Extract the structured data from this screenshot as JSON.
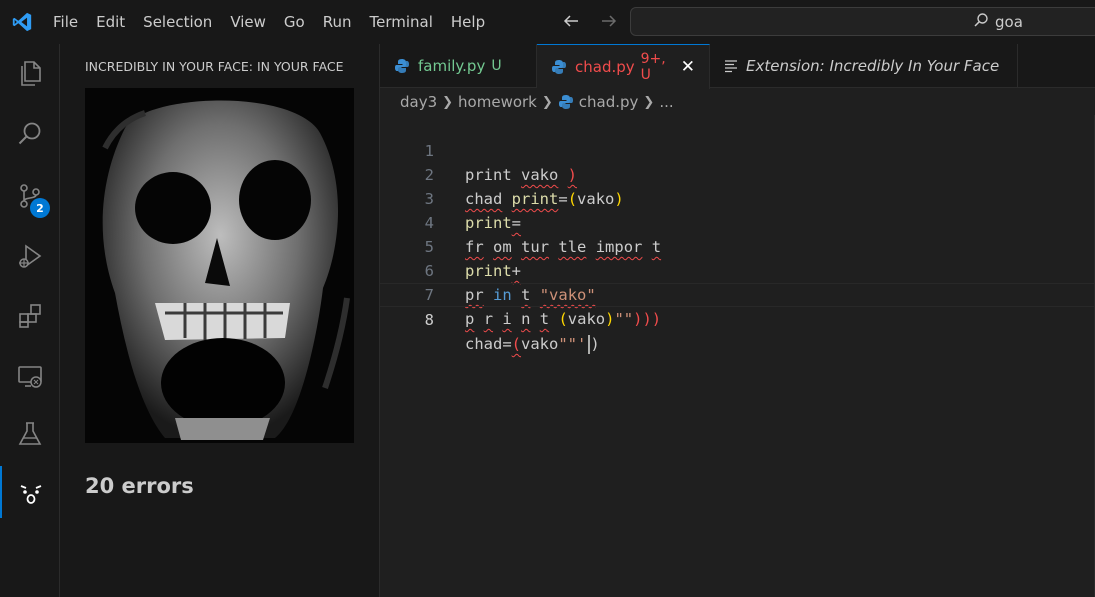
{
  "menu": {
    "items": [
      "File",
      "Edit",
      "Selection",
      "View",
      "Go",
      "Run",
      "Terminal",
      "Help"
    ]
  },
  "command_center": {
    "text": "goa",
    "icon": "search-icon"
  },
  "activity_bar": {
    "items": [
      {
        "name": "explorer",
        "icon": "files-icon"
      },
      {
        "name": "search",
        "icon": "search-icon"
      },
      {
        "name": "source-control",
        "icon": "source-control-icon",
        "badge": "2"
      },
      {
        "name": "run-debug",
        "icon": "run-debug-icon"
      },
      {
        "name": "extensions",
        "icon": "extensions-icon"
      },
      {
        "name": "remote-explorer",
        "icon": "remote-explorer-icon"
      },
      {
        "name": "testing",
        "icon": "flask-icon"
      },
      {
        "name": "in-your-face",
        "icon": "shocked-face-icon",
        "active": true
      }
    ]
  },
  "sidebar": {
    "title": "INCREDIBLY IN YOUR FACE: IN YOUR FACE",
    "errors_label": "20 errors"
  },
  "tabs": [
    {
      "label": "family.py",
      "status": "U",
      "color": "#73c991"
    },
    {
      "label": "chad.py",
      "status": "9+, U",
      "color": "#f14c4c",
      "active": true
    },
    {
      "label": "Extension: Incredibly In Your Face",
      "status": "",
      "color": "#cccccc"
    }
  ],
  "breadcrumbs": [
    "day3",
    "homework",
    "chad.py",
    "..."
  ],
  "editor": {
    "line_numbers": [
      "1",
      "2",
      "3",
      "4",
      "5",
      "6",
      "7",
      "8"
    ],
    "current_line": 8
  },
  "colors": {
    "accent": "#0078d4",
    "error": "#f14c4c",
    "untracked": "#73c991"
  }
}
